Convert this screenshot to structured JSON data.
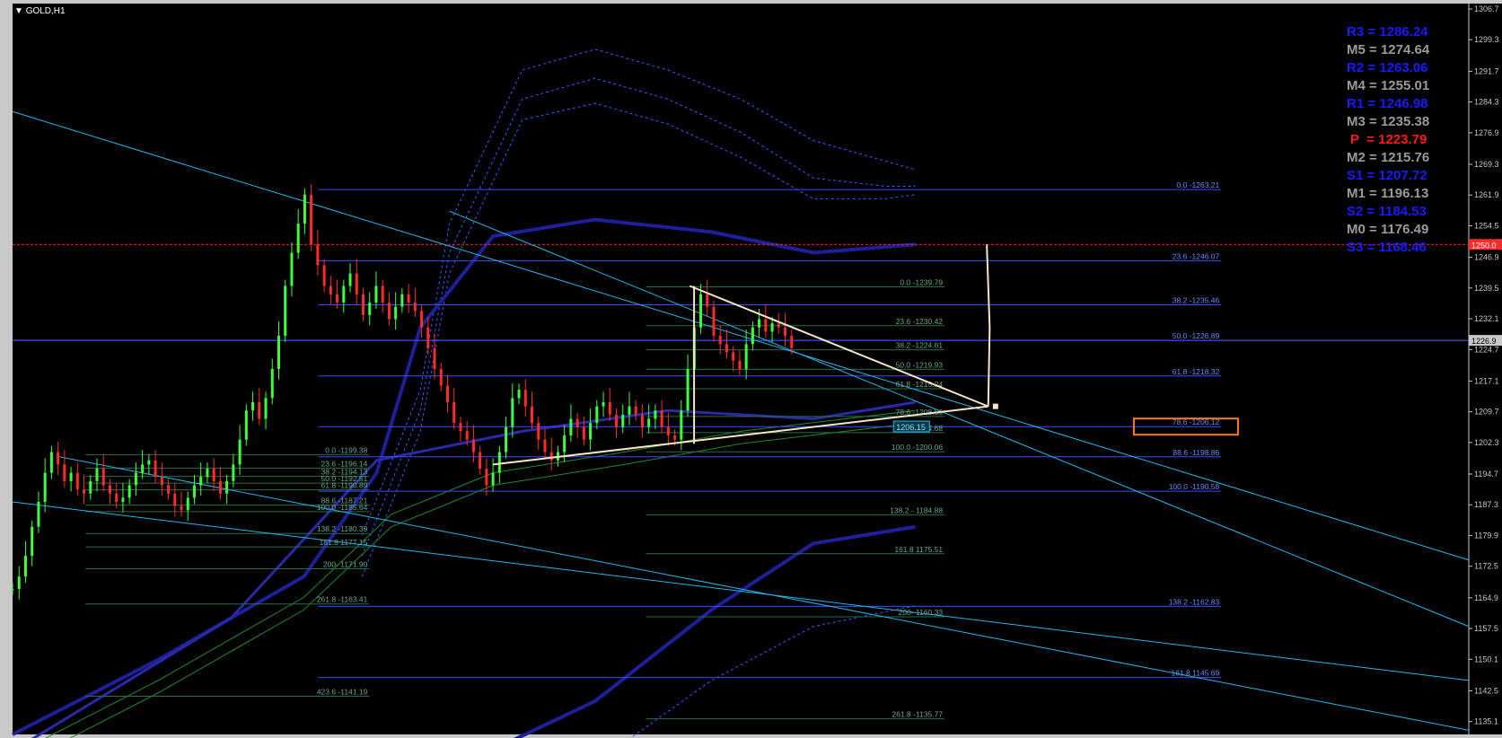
{
  "symbol": {
    "label": "GOLD,H1"
  },
  "colors": {
    "background": "#000000",
    "grid_text": "#c8c8c8",
    "fib_line": "#3a4dff",
    "fib_line_dark": "#2a6b4a",
    "trend": "#29b6e8",
    "triangle": "#f5e6c8",
    "bull": "#3cff3c",
    "bear": "#ff2a2a",
    "highlight_box": "#ff7a1f",
    "current_price_tag": "#c8c8c8",
    "red_level": "#ff2a2a",
    "ma_dark_blue": "#1f1f9a"
  },
  "pivots": [
    {
      "label": "R3",
      "value": "1286.24",
      "color": "#1a1aff"
    },
    {
      "label": "M5",
      "value": "1274.64",
      "color": "#9a9a9a"
    },
    {
      "label": "R2",
      "value": "1263.06",
      "color": "#1a1aff"
    },
    {
      "label": "M4",
      "value": "1255.01",
      "color": "#9a9a9a"
    },
    {
      "label": "R1",
      "value": "1246.98",
      "color": "#1a1aff"
    },
    {
      "label": "M3",
      "value": "1235.38",
      "color": "#9a9a9a"
    },
    {
      "label": "P",
      "value": "1223.79",
      "color": "#ff1a1a"
    },
    {
      "label": "M2",
      "value": "1215.76",
      "color": "#9a9a9a"
    },
    {
      "label": "S1",
      "value": "1207.72",
      "color": "#1a1aff"
    },
    {
      "label": "M1",
      "value": "1196.13",
      "color": "#9a9a9a"
    },
    {
      "label": "S2",
      "value": "1184.53",
      "color": "#1a1aff"
    },
    {
      "label": "M0",
      "value": "1176.49",
      "color": "#9a9a9a"
    },
    {
      "label": "S3",
      "value": "1168.46",
      "color": "#1a1aff"
    }
  ],
  "chart_data": {
    "type": "candlestick",
    "ylim": [
      1132.0,
      1308.0
    ],
    "yticks": [
      "1306.7",
      "1299.3",
      "1291.7",
      "1284.3",
      "1276.9",
      "1269.3",
      "1261.9",
      "1254.5",
      "1246.9",
      "1239.5",
      "1232.1",
      "1224.7",
      "1217.1",
      "1209.7",
      "1202.3",
      "1194.7",
      "1187.3",
      "1179.9",
      "1172.5",
      "1164.9",
      "1157.5",
      "1150.1",
      "1142.5",
      "1135.1"
    ],
    "current_price": {
      "value": 1226.9,
      "label": "1226.9"
    },
    "red_level": {
      "value": 1250.0,
      "label": "1250.0"
    },
    "fib_labels": [
      {
        "text": "0.0 -1263.21",
        "y": 1263.21,
        "x0": 0.21,
        "x1": 0.83,
        "label_x": 0.83,
        "style": "blue"
      },
      {
        "text": "23.6 -1246.07",
        "y": 1246.07,
        "x0": 0.21,
        "x1": 0.83,
        "label_x": 0.83,
        "style": "blue"
      },
      {
        "text": "38.2 -1235.46",
        "y": 1235.46,
        "x0": 0.21,
        "x1": 0.83,
        "label_x": 0.83,
        "style": "blue"
      },
      {
        "text": "50.0 -1226.89",
        "y": 1226.89,
        "x0": 0.0,
        "x1": 0.83,
        "label_x": 0.83,
        "style": "blue"
      },
      {
        "text": "61.8 -1218.32",
        "y": 1218.32,
        "x0": 0.21,
        "x1": 0.83,
        "label_x": 0.83,
        "style": "blue"
      },
      {
        "text": "78.6 -1206.12",
        "y": 1206.12,
        "x0": 0.21,
        "x1": 0.83,
        "label_x": 0.83,
        "style": "blue"
      },
      {
        "text": "88.6 -1198.86",
        "y": 1198.86,
        "x0": 0.21,
        "x1": 0.83,
        "label_x": 0.83,
        "style": "blue"
      },
      {
        "text": "100.0 -1190.58",
        "y": 1190.58,
        "x0": 0.21,
        "x1": 0.83,
        "label_x": 0.83,
        "style": "blue"
      },
      {
        "text": "138.2 -1162.83",
        "y": 1162.83,
        "x0": 0.21,
        "x1": 0.83,
        "label_x": 0.83,
        "style": "blue"
      },
      {
        "text": "161.8 1145.69",
        "y": 1145.69,
        "x0": 0.21,
        "x1": 0.83,
        "label_x": 0.83,
        "style": "blue"
      },
      {
        "text": "0.0 -1239.79",
        "y": 1239.79,
        "x0": 0.435,
        "x1": 0.64,
        "label_x": 0.64,
        "style": "dark"
      },
      {
        "text": "23.6 -1230.42",
        "y": 1230.42,
        "x0": 0.435,
        "x1": 0.64,
        "label_x": 0.64,
        "style": "dark"
      },
      {
        "text": "38.2 -1224.61",
        "y": 1224.61,
        "x0": 0.435,
        "x1": 0.64,
        "label_x": 0.64,
        "style": "dark"
      },
      {
        "text": "50.0 -1219.93",
        "y": 1219.93,
        "x0": 0.435,
        "x1": 0.64,
        "label_x": 0.64,
        "style": "dark"
      },
      {
        "text": "61.8 -1215.24",
        "y": 1215.24,
        "x0": 0.435,
        "x1": 0.64,
        "label_x": 0.64,
        "style": "dark"
      },
      {
        "text": "78.6 -1208.56",
        "y": 1208.56,
        "x0": 0.435,
        "x1": 0.64,
        "label_x": 0.64,
        "style": "dark"
      },
      {
        "text": "88.6 -1204.68",
        "y": 1204.68,
        "x0": 0.435,
        "x1": 0.64,
        "label_x": 0.64,
        "style": "dark"
      },
      {
        "text": "100.0 -1200.06",
        "y": 1200.06,
        "x0": 0.435,
        "x1": 0.64,
        "label_x": 0.64,
        "style": "dark"
      },
      {
        "text": "138.2 - 1184.88",
        "y": 1184.88,
        "x0": 0.435,
        "x1": 0.64,
        "label_x": 0.64,
        "style": "dark"
      },
      {
        "text": "161.8 1175.51",
        "y": 1175.51,
        "x0": 0.435,
        "x1": 0.64,
        "label_x": 0.64,
        "style": "dark"
      },
      {
        "text": "200- 1160.33",
        "y": 1160.33,
        "x0": 0.435,
        "x1": 0.64,
        "label_x": 0.64,
        "style": "dark"
      },
      {
        "text": "261.8 -1135.77",
        "y": 1135.77,
        "x0": 0.435,
        "x1": 0.64,
        "label_x": 0.64,
        "style": "dark"
      },
      {
        "text": "0.0 -1199.38",
        "y": 1199.38,
        "x0": 0.05,
        "x1": 0.245,
        "label_x": 0.245,
        "style": "dark"
      },
      {
        "text": "23.6 -1196.14",
        "y": 1196.14,
        "x0": 0.05,
        "x1": 0.245,
        "label_x": 0.245,
        "style": "dark"
      },
      {
        "text": "38.2 -1194.13",
        "y": 1194.13,
        "x0": 0.05,
        "x1": 0.245,
        "label_x": 0.245,
        "style": "dark"
      },
      {
        "text": "50.0 -1192.51",
        "y": 1192.51,
        "x0": 0.05,
        "x1": 0.245,
        "label_x": 0.245,
        "style": "dark"
      },
      {
        "text": "61.8 -1190.89",
        "y": 1190.89,
        "x0": 0.05,
        "x1": 0.245,
        "label_x": 0.245,
        "style": "dark"
      },
      {
        "text": "88.6 -1187.21",
        "y": 1187.21,
        "x0": 0.05,
        "x1": 0.245,
        "label_x": 0.245,
        "style": "dark"
      },
      {
        "text": "100.0 -1185.64",
        "y": 1185.64,
        "x0": 0.05,
        "x1": 0.245,
        "label_x": 0.245,
        "style": "dark"
      },
      {
        "text": "138.2 -1180.39",
        "y": 1180.39,
        "x0": 0.05,
        "x1": 0.245,
        "label_x": 0.245,
        "style": "dark"
      },
      {
        "text": "161.8 1177.15",
        "y": 1177.15,
        "x0": 0.05,
        "x1": 0.245,
        "label_x": 0.245,
        "style": "dark"
      },
      {
        "text": "200- 1171.90",
        "y": 1171.9,
        "x0": 0.05,
        "x1": 0.245,
        "label_x": 0.245,
        "style": "dark"
      },
      {
        "text": "261.8 -1163.41",
        "y": 1163.41,
        "x0": 0.05,
        "x1": 0.245,
        "label_x": 0.245,
        "style": "dark"
      },
      {
        "text": "423.6 -1141.19",
        "y": 1141.19,
        "x0": 0.05,
        "x1": 0.245,
        "label_x": 0.245,
        "style": "dark"
      }
    ],
    "highlight_label": {
      "text": "78.6 -1206.12",
      "y": 1206.12
    },
    "triangle_label": {
      "text": "1206.15",
      "y": 1206.15
    },
    "candles_seed_path": [
      1167,
      1170,
      1175,
      1182,
      1188,
      1195,
      1200,
      1197,
      1193,
      1195,
      1191,
      1190,
      1193,
      1196,
      1192,
      1190,
      1188,
      1189,
      1192,
      1195,
      1197,
      1198,
      1194,
      1192,
      1190,
      1187,
      1186,
      1189,
      1192,
      1194,
      1196,
      1193,
      1190,
      1193,
      1197,
      1203,
      1210,
      1212,
      1208,
      1213,
      1220,
      1228,
      1240,
      1248,
      1255,
      1262,
      1250,
      1245,
      1240,
      1238,
      1236,
      1240,
      1243,
      1238,
      1233,
      1236,
      1240,
      1236,
      1232,
      1235,
      1238,
      1236,
      1234,
      1230,
      1225,
      1220,
      1216,
      1212,
      1207,
      1205,
      1203,
      1200,
      1196,
      1192,
      1195,
      1200,
      1206,
      1213,
      1215,
      1211,
      1207,
      1203,
      1200,
      1198,
      1200,
      1204,
      1208,
      1206,
      1203,
      1207,
      1211,
      1212,
      1209,
      1206,
      1209,
      1211,
      1209,
      1206,
      1208,
      1210,
      1206,
      1204,
      1203,
      1210,
      1220,
      1230,
      1238,
      1235,
      1228,
      1226,
      1224,
      1222,
      1220,
      1226,
      1230,
      1232,
      1229,
      1231,
      1230,
      1228,
      1225
    ]
  }
}
